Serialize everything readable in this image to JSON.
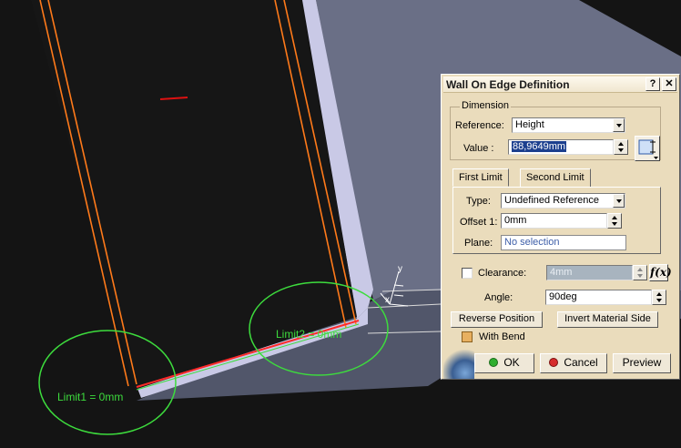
{
  "viewport": {
    "annotations": {
      "limit1": "Limit1 = 0mm",
      "limit2": "Limit2 = 0mm"
    },
    "axis_labels": {
      "y": "y",
      "x": "x"
    },
    "colors": {
      "annotation": "#3ddc3d",
      "edge": "#ff7a1a",
      "highlight": "#ff2a2a",
      "background": "#141414",
      "wall": "#9898b8"
    }
  },
  "dialog": {
    "title": "Wall On Edge Definition",
    "help_label": "?",
    "close_label": "✕",
    "dimension": {
      "legend": "Dimension",
      "reference_label": "Reference:",
      "reference_value": "Height",
      "value_label": "Value :",
      "value": "88,9649mm"
    },
    "tabs": [
      "First Limit",
      "Second Limit"
    ],
    "limit": {
      "type_label": "Type:",
      "type_value": "Undefined Reference",
      "offset_label": "Offset 1:",
      "offset_value": "0mm",
      "plane_label": "Plane:",
      "plane_value": "No selection"
    },
    "clearance": {
      "label": "Clearance:",
      "value": "4mm",
      "checked": false
    },
    "fx_label": "f(x)",
    "angle": {
      "label": "Angle:",
      "value": "90deg"
    },
    "buttons": {
      "reverse_position": "Reverse Position",
      "invert_material_side": "Invert Material Side",
      "ok": "OK",
      "cancel": "Cancel",
      "preview": "Preview"
    },
    "with_bend": {
      "label": "With Bend",
      "checked": true
    }
  }
}
